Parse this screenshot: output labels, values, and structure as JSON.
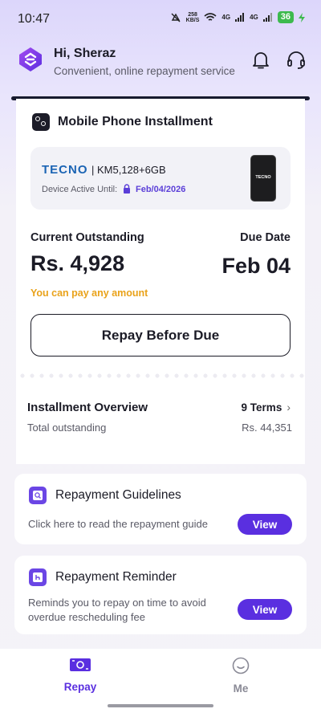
{
  "status_bar": {
    "time": "10:47",
    "network_speed": "258",
    "network_unit": "KB/S",
    "signal_1": "4G",
    "signal_2": "4G",
    "battery": "36"
  },
  "header": {
    "greeting": "Hi, Sheraz",
    "tagline": "Convenient, online repayment service"
  },
  "installment": {
    "title": "Mobile Phone Installment",
    "brand": "TECNO",
    "model": "| KM5,128+6GB",
    "active_label": "Device Active Until:",
    "active_date": "Feb/04/2026",
    "phone_label": "TECNO",
    "outstanding_label": "Current Outstanding",
    "due_label": "Due Date",
    "amount": "Rs. 4,928",
    "due_date": "Feb 04",
    "any_amount": "You can pay any amount",
    "repay_button": "Repay Before Due"
  },
  "overview": {
    "title": "Installment Overview",
    "terms": "9 Terms",
    "sub_label": "Total outstanding",
    "total": "Rs. 44,351"
  },
  "guidelines": {
    "title": "Repayment Guidelines",
    "desc": "Click here to read the repayment guide",
    "button": "View"
  },
  "reminder": {
    "title": "Repayment Reminder",
    "desc": "Reminds you to repay on time to avoid overdue rescheduling fee",
    "button": "View"
  },
  "nav": {
    "repay": "Repay",
    "me": "Me"
  },
  "colors": {
    "accent": "#5a2fe0",
    "warning": "#e9a21a",
    "brand_blue": "#1b64b4"
  }
}
